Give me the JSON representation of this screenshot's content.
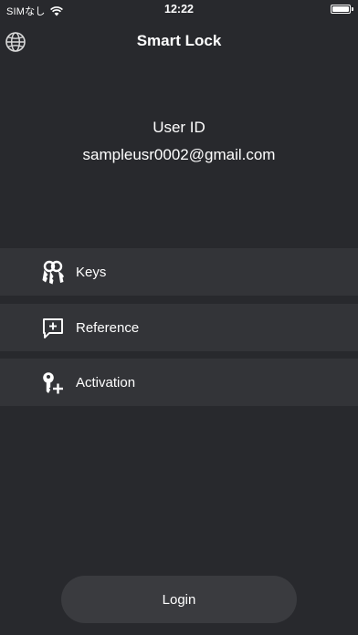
{
  "status_bar": {
    "carrier": "SIMなし",
    "time": "12:22",
    "icons": [
      "wifi-icon",
      "battery-icon"
    ]
  },
  "header": {
    "title": "Smart Lock",
    "icon": "globe-icon"
  },
  "user": {
    "label": "User ID",
    "email": "sampleusr0002@gmail.com"
  },
  "menu": {
    "items": [
      {
        "label": "Keys",
        "icon": "keys-icon"
      },
      {
        "label": "Reference",
        "icon": "message-plus-icon"
      },
      {
        "label": "Activation",
        "icon": "key-plus-icon"
      }
    ]
  },
  "footer": {
    "login_label": "Login"
  },
  "colors": {
    "background": "#28292d",
    "menu_row": "#333438",
    "button": "#3a3b3f",
    "text": "#ffffff"
  }
}
